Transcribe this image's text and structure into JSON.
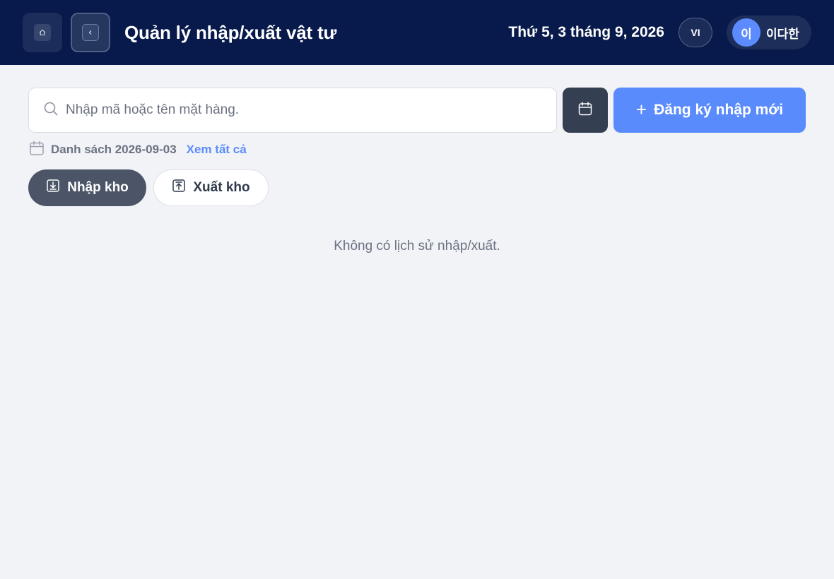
{
  "header": {
    "title": "Quản lý nhập/xuất vật tư",
    "date": "Thứ 5, 3 tháng 9, 2026",
    "language": "VI",
    "user": {
      "avatar_initial": "이",
      "name": "이다한"
    },
    "icons": {
      "home": "home-icon",
      "back": "chevron-left-icon"
    }
  },
  "toolbar": {
    "search_placeholder": "Nhập mã hoặc tên mặt hàng.",
    "search_value": "",
    "calendar_icon": "calendar-icon",
    "new_button_label": "Đăng ký nhập mới"
  },
  "list": {
    "label": "Danh sách 2026-09-03",
    "view_all": "Xem tất cả"
  },
  "tabs": [
    {
      "label": "Nhập kho",
      "icon": "download-icon",
      "active": true
    },
    {
      "label": "Xuất kho",
      "icon": "upload-icon",
      "active": false
    }
  ],
  "empty_message": "Không có lịch sử nhập/xuất.",
  "colors": {
    "header_bg": "#071a4b",
    "accent": "#5a8bfd",
    "active_tab": "#4b5567",
    "page_bg": "#f1f3f7"
  }
}
